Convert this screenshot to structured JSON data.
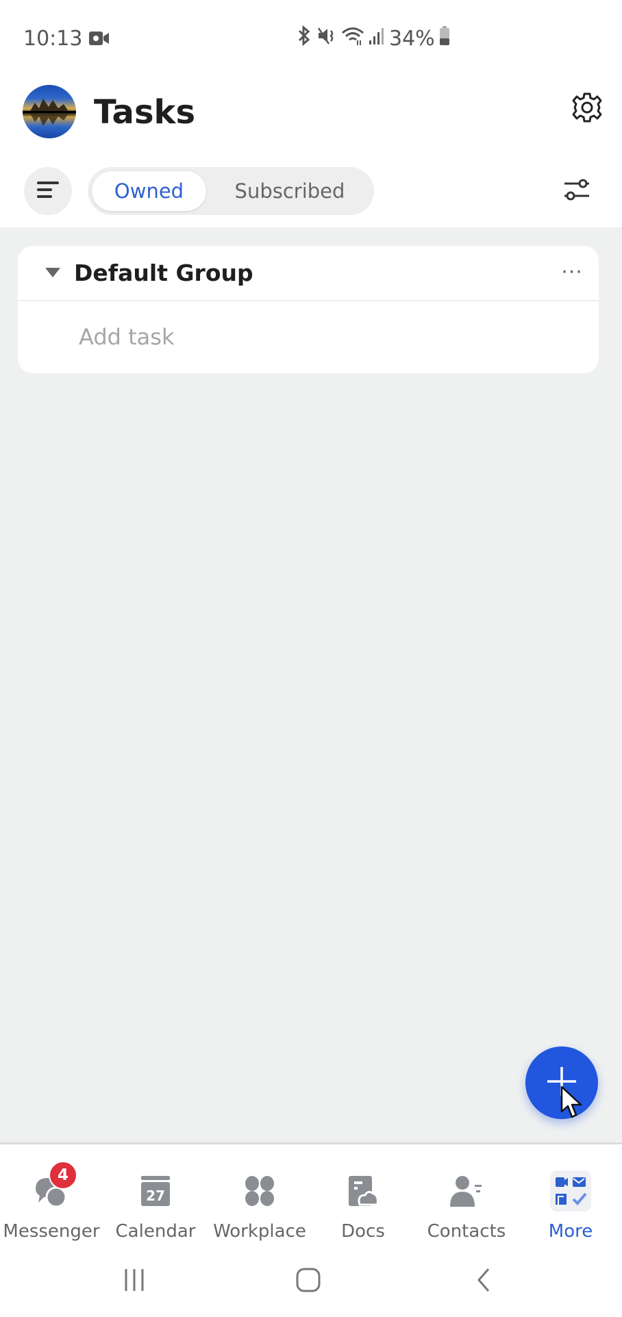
{
  "status_bar": {
    "time": "10:13",
    "battery": "34%",
    "icons": [
      "video-recording-icon",
      "bluetooth-icon",
      "mute-icon",
      "wifi-icon",
      "signal-icon",
      "battery-icon"
    ]
  },
  "header": {
    "title": "Tasks",
    "avatar": "user-avatar",
    "settings_icon": "gear-icon"
  },
  "toolbar": {
    "menu_icon": "menu-icon",
    "segments": [
      {
        "label": "Owned",
        "selected": true
      },
      {
        "label": "Subscribed",
        "selected": false
      }
    ],
    "filter_icon": "sliders-icon"
  },
  "group": {
    "name": "Default Group",
    "expanded": true,
    "more_label": "···",
    "add_task_placeholder": "Add task"
  },
  "fab": {
    "icon": "plus-icon"
  },
  "bottom_nav": {
    "items": [
      {
        "label": "Messenger",
        "icon": "messenger-icon",
        "badge": "4",
        "active": false
      },
      {
        "label": "Calendar",
        "icon": "calendar-icon",
        "day": "27",
        "active": false
      },
      {
        "label": "Workplace",
        "icon": "workplace-icon",
        "active": false
      },
      {
        "label": "Docs",
        "icon": "docs-icon",
        "active": false
      },
      {
        "label": "Contacts",
        "icon": "contacts-icon",
        "active": false
      },
      {
        "label": "More",
        "icon": "more-apps-icon",
        "active": true
      }
    ]
  },
  "system_nav": [
    "recents-button",
    "home-button",
    "back-button"
  ],
  "colors": {
    "accent": "#2156de",
    "accent_text": "#2d5fcf",
    "badge": "#e0303c",
    "background": "#eff1f1",
    "icon_gray": "#8a8e93"
  }
}
